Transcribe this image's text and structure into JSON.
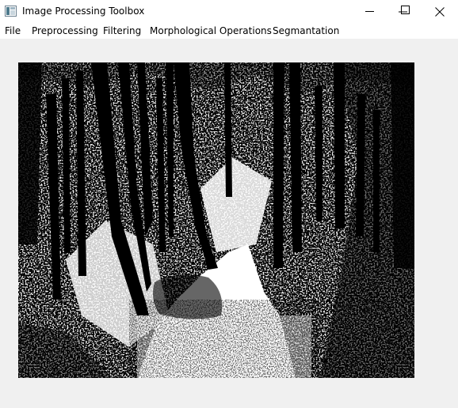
{
  "window": {
    "title": "Image Processing Toolbox",
    "controls": [
      "minimize",
      "maximize",
      "close"
    ]
  },
  "menu": {
    "items": [
      {
        "label": "File"
      },
      {
        "label": "Preprocessing"
      },
      {
        "label": "Filtering"
      },
      {
        "label": "Morphological Operations"
      },
      {
        "label": "Segmantation"
      }
    ]
  },
  "image": {
    "subject": "binary-thresholded forest path",
    "colors": {
      "foreground": "#ffffff",
      "background": "#000000"
    }
  }
}
